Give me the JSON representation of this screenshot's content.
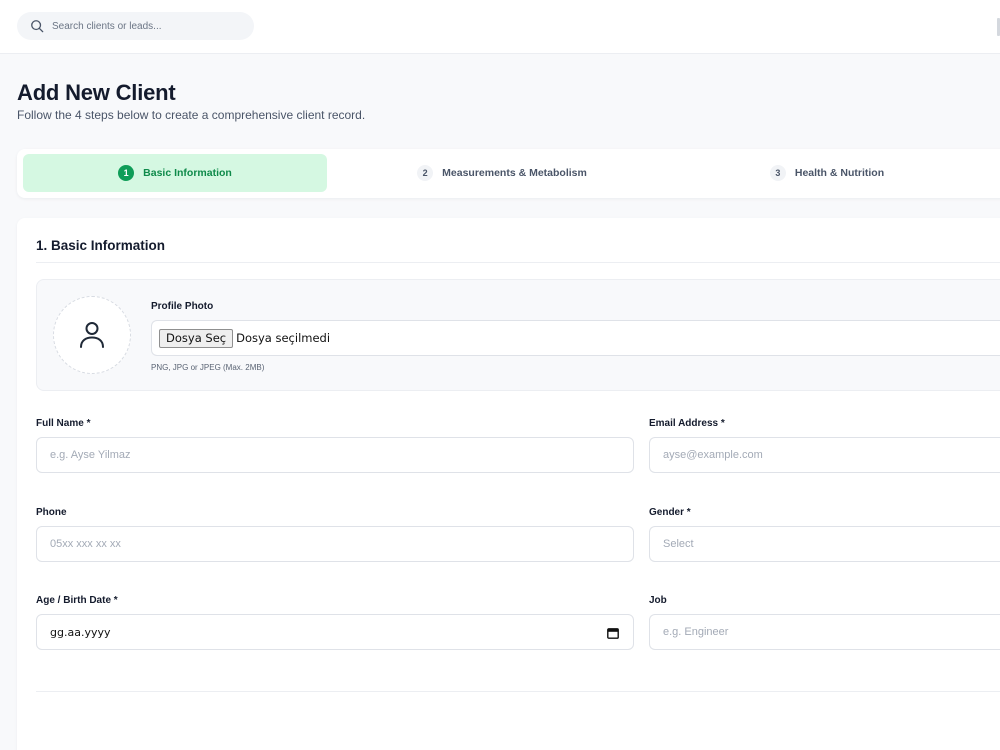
{
  "search": {
    "placeholder": "Search clients or leads..."
  },
  "header": {
    "title": "Add New Client",
    "subtitle": "Follow the 4 steps below to create a comprehensive client record."
  },
  "steps": [
    {
      "number": "1",
      "label": "Basic Information",
      "active": true
    },
    {
      "number": "2",
      "label": "Measurements & Metabolism",
      "active": false
    },
    {
      "number": "3",
      "label": "Health & Nutrition",
      "active": false
    }
  ],
  "form": {
    "section_title": "1. Basic Information",
    "photo": {
      "label": "Profile Photo",
      "button": "Dosya Seç",
      "status": "Dosya seçilmedi",
      "hint": "PNG, JPG or JPEG (Max. 2MB)"
    },
    "full_name": {
      "label": "Full Name *",
      "placeholder": "e.g. Ayse Yilmaz"
    },
    "email": {
      "label": "Email Address *",
      "placeholder": "ayse@example.com"
    },
    "phone": {
      "label": "Phone",
      "placeholder": "05xx xxx xx xx"
    },
    "gender": {
      "label": "Gender *",
      "selected": "Select"
    },
    "birth_date": {
      "label": "Age / Birth Date *",
      "value": "gg.aa.yyyy"
    },
    "job": {
      "label": "Job",
      "placeholder": "e.g. Engineer"
    }
  },
  "icons": {
    "search": "search-icon",
    "avatar": "user-icon",
    "calendar": "calendar-icon"
  },
  "colors": {
    "accent": "#0f9d58",
    "accent_bg": "#d5f8e2"
  }
}
